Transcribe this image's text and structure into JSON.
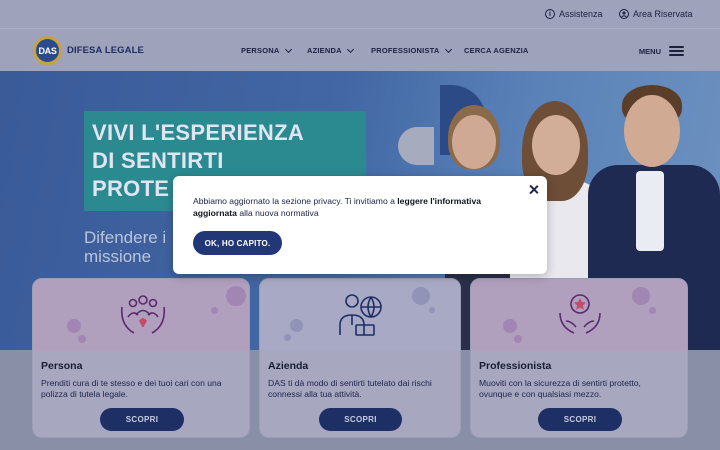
{
  "utility": {
    "assistenza": "Assistenza",
    "area_riservata": "Area Riservata"
  },
  "header": {
    "logo_badge": "DAS",
    "logo_text": "DIFESA LEGALE",
    "nav": [
      "PERSONA",
      "AZIENDA",
      "PROFESSIONISTA",
      "CERCA AGENZIA"
    ],
    "menu_label": "MENU"
  },
  "hero": {
    "title_line1": "VIVI L'ESPERIENZA",
    "title_line2": "DI SENTIRTI",
    "title_line3": "PROTE",
    "subtitle_line1": "Difendere i",
    "subtitle_line2": "missione"
  },
  "cards": [
    {
      "title": "Persona",
      "desc": "Prenditi cura di te stesso e dei tuoi cari con una polizza di tutela legale.",
      "button": "SCOPRI",
      "icon": "family-hands-icon"
    },
    {
      "title": "Azienda",
      "desc": "DAS ti dà modo di sentirti tutelato dai rischi connessi alla tua attività.",
      "button": "SCOPRI",
      "icon": "businessman-globe-icon"
    },
    {
      "title": "Professionista",
      "desc": "Muoviti con la sicurezza di sentirti protetto, ovunque e con qualsiasi mezzo.",
      "button": "SCOPRI",
      "icon": "award-hands-icon"
    }
  ],
  "modal": {
    "text_before": "Abbiamo aggiornato la sezione privacy. Ti invitiamo a ",
    "text_bold": "leggere l'informativa aggiornata",
    "text_after": " alla nuova normativa",
    "button": "OK, HO CAPITO."
  },
  "colors": {
    "brand_blue": "#223777",
    "hero_teal": "#2b8a90",
    "accent_purple": "#9d7fb1"
  }
}
